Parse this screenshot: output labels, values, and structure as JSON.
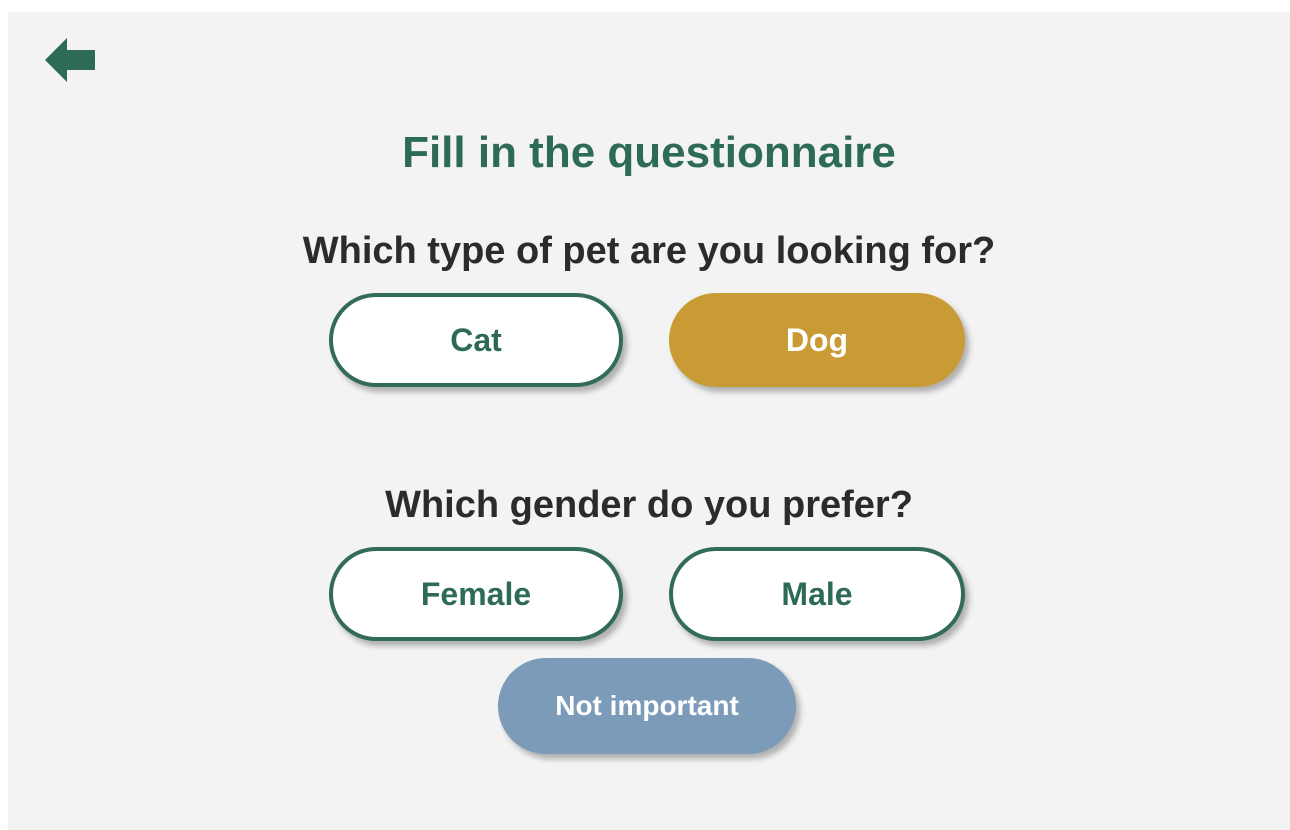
{
  "header": {
    "back_icon": "arrow-left-icon",
    "title": "Fill in the questionnaire"
  },
  "questions": [
    {
      "text": "Which type of pet are you looking for?",
      "options": [
        {
          "label": "Cat",
          "selected": false
        },
        {
          "label": "Dog",
          "selected": true
        }
      ]
    },
    {
      "text": "Which gender do you prefer?",
      "options": [
        {
          "label": "Female",
          "selected": false
        },
        {
          "label": "Male",
          "selected": false
        },
        {
          "label": "Not important",
          "selected": false
        }
      ]
    }
  ],
  "colors": {
    "brand_green": "#2e6b57",
    "background": "#f3f3f3",
    "selected": "#c99b34",
    "neutral": "#7b9bb8",
    "question_text": "#2b2b2b"
  }
}
